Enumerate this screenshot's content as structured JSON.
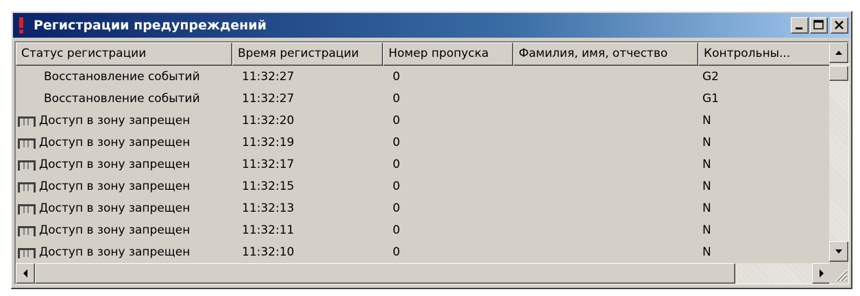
{
  "window": {
    "title": "Регистрации предупреждений",
    "controls": [
      "minimize",
      "maximize",
      "close"
    ]
  },
  "columns": [
    "Статус регистрации",
    "Время регистрации",
    "Номер пропуска",
    "Фамилия, имя, отчество",
    "Контрольны..."
  ],
  "rows": [
    {
      "status": "Восстановление событий",
      "time": "11:32:27",
      "pass": "0",
      "name": "",
      "control": "G2",
      "icon": ""
    },
    {
      "status": "Восстановление событий",
      "time": "11:32:27",
      "pass": "0",
      "name": "",
      "control": "G1",
      "icon": ""
    },
    {
      "status": "Доступ в зону запрещен",
      "time": "11:32:20",
      "pass": "0",
      "name": "",
      "control": "N",
      "icon": "turnstile-icon"
    },
    {
      "status": "Доступ в зону запрещен",
      "time": "11:32:19",
      "pass": "0",
      "name": "",
      "control": "N",
      "icon": "turnstile-icon"
    },
    {
      "status": "Доступ в зону запрещен",
      "time": "11:32:17",
      "pass": "0",
      "name": "",
      "control": "N",
      "icon": "turnstile-icon"
    },
    {
      "status": "Доступ в зону запрещен",
      "time": "11:32:15",
      "pass": "0",
      "name": "",
      "control": "N",
      "icon": "turnstile-icon"
    },
    {
      "status": "Доступ в зону запрещен",
      "time": "11:32:13",
      "pass": "0",
      "name": "",
      "control": "N",
      "icon": "turnstile-icon"
    },
    {
      "status": "Доступ в зону запрещен",
      "time": "11:32:11",
      "pass": "0",
      "name": "",
      "control": "N",
      "icon": "turnstile-icon"
    },
    {
      "status": "Доступ в зону запрещен",
      "time": "11:32:10",
      "pass": "0",
      "name": "",
      "control": "N",
      "icon": "turnstile-icon"
    }
  ],
  "colors": {
    "titlebar_start": "#0a246a",
    "titlebar_end": "#a6caf0",
    "face": "#d4d0c8",
    "alert_icon": "#e0201a"
  }
}
